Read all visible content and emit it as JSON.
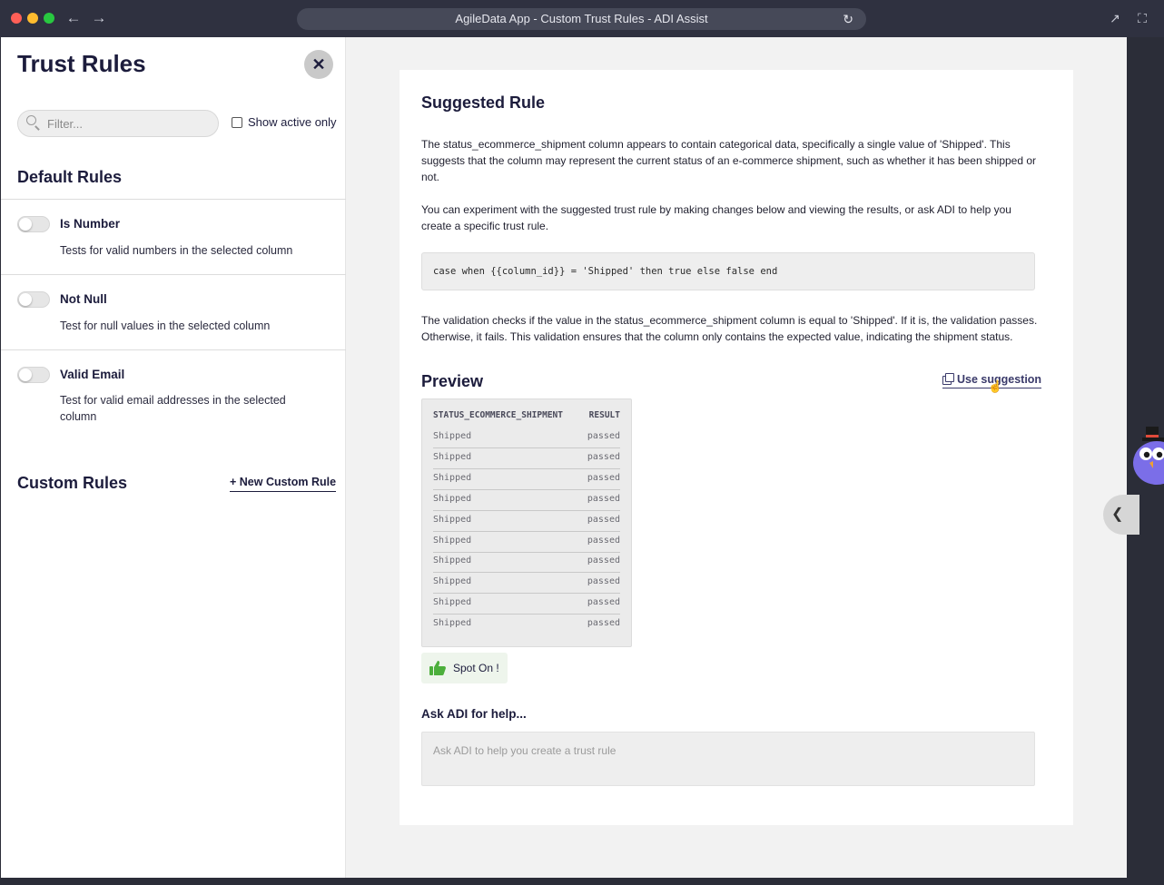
{
  "window": {
    "title": "AgileData App - Custom Trust Rules - ADI Assist"
  },
  "sidebar": {
    "title": "Trust Rules",
    "filter_placeholder": "Filter...",
    "show_active_label": "Show active only",
    "default_rules_title": "Default Rules",
    "rules": [
      {
        "name": "Is Number",
        "description": "Tests for valid numbers in the selected column"
      },
      {
        "name": "Not Null",
        "description": "Test for null values in the selected column"
      },
      {
        "name": "Valid Email",
        "description": "Test for valid email addresses in the selected column"
      }
    ],
    "custom_rules_title": "Custom Rules",
    "new_custom_rule_label": "+ New Custom Rule"
  },
  "main": {
    "suggested_title": "Suggested Rule",
    "intro_paragraph": "The status_ecommerce_shipment column appears to contain categorical data, specifically a single value of 'Shipped'. This suggests that the column may represent the current status of an e-commerce shipment, such as whether it has been shipped or not.",
    "experiment_paragraph": "You can experiment with the suggested trust rule by making changes below and viewing the results, or ask ADI to help you create a specific trust rule.",
    "code": "case when {{column_id}} = 'Shipped' then true else false end",
    "validation_paragraph": "The validation checks if the value in the status_ecommerce_shipment column is equal to 'Shipped'. If it is, the validation passes. Otherwise, it fails. This validation ensures that the column only contains the expected value, indicating the shipment status.",
    "preview_title": "Preview",
    "use_suggestion_label": "Use suggestion",
    "preview_table": {
      "columns": [
        "STATUS_ECOMMERCE_SHIPMENT",
        "RESULT"
      ],
      "rows": [
        [
          "Shipped",
          "passed"
        ],
        [
          "Shipped",
          "passed"
        ],
        [
          "Shipped",
          "passed"
        ],
        [
          "Shipped",
          "passed"
        ],
        [
          "Shipped",
          "passed"
        ],
        [
          "Shipped",
          "passed"
        ],
        [
          "Shipped",
          "passed"
        ],
        [
          "Shipped",
          "passed"
        ],
        [
          "Shipped",
          "passed"
        ],
        [
          "Shipped",
          "passed"
        ]
      ]
    },
    "spot_on_label": "Spot On !",
    "ask_title": "Ask ADI for help...",
    "ask_placeholder": "Ask ADI to help you create a trust rule"
  },
  "colors": {
    "accent": "#1c1c3c",
    "thumb_green": "#4caf3c",
    "chrome": "#2f3140"
  }
}
